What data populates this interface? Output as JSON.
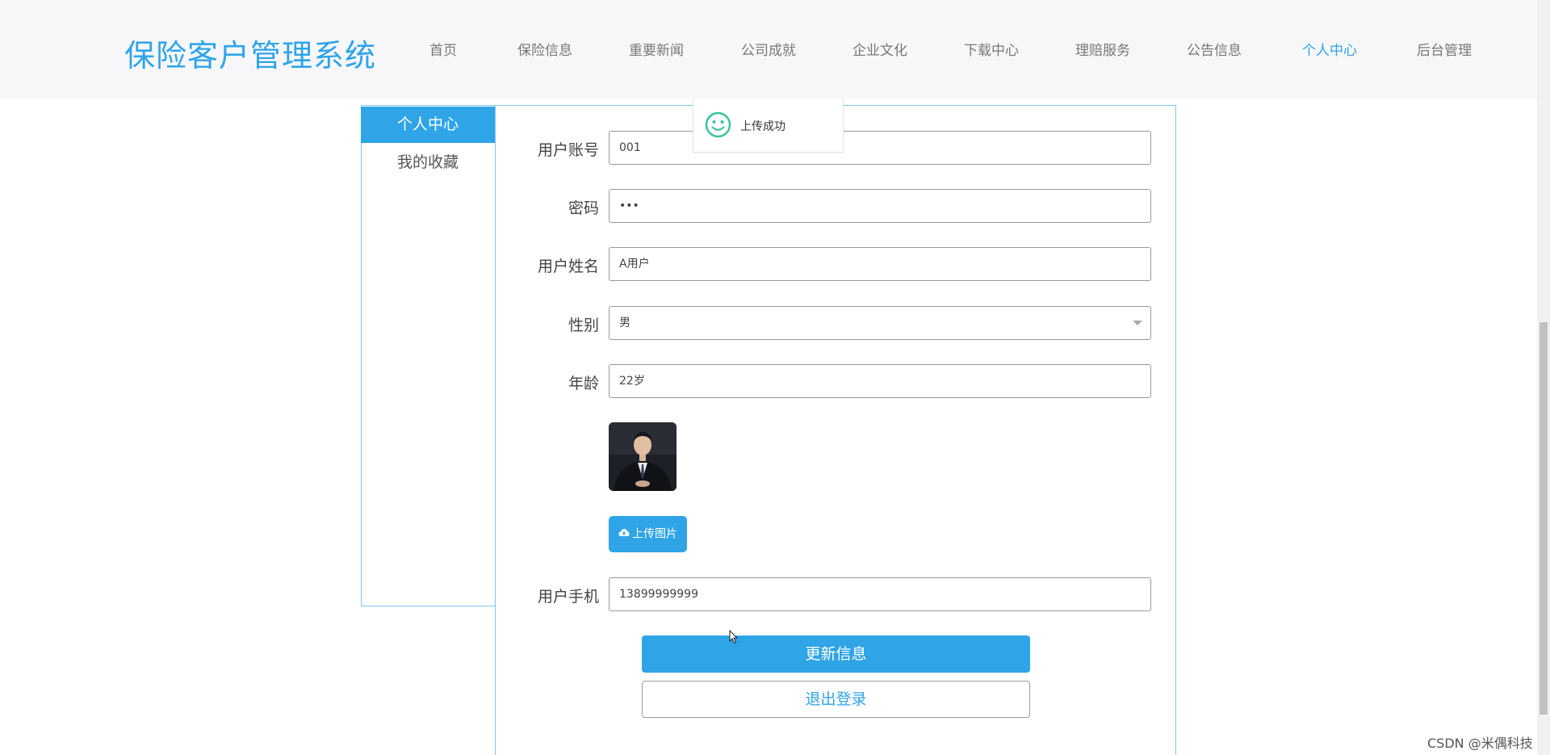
{
  "header": {
    "logo": "保险客户管理系统",
    "nav": [
      {
        "label": "首页"
      },
      {
        "label": "保险信息"
      },
      {
        "label": "重要新闻"
      },
      {
        "label": "公司成就"
      },
      {
        "label": "企业文化"
      },
      {
        "label": "下载中心"
      },
      {
        "label": "理赔服务"
      },
      {
        "label": "公告信息"
      },
      {
        "label": "个人中心"
      },
      {
        "label": "后台管理"
      }
    ],
    "active_nav": "个人中心"
  },
  "sidebar": {
    "items": [
      {
        "label": "个人中心"
      },
      {
        "label": "我的收藏"
      }
    ]
  },
  "form": {
    "account": {
      "label": "用户账号",
      "value": "001"
    },
    "password": {
      "label": "密码",
      "value": "•••"
    },
    "name": {
      "label": "用户姓名",
      "value": "A用户"
    },
    "gender": {
      "label": "性别",
      "value": "男"
    },
    "age": {
      "label": "年龄",
      "value": "22岁"
    },
    "upload_button": "上传图片",
    "phone": {
      "label": "用户手机",
      "value": "13899999999"
    },
    "update_button": "更新信息",
    "logout_button": "退出登录"
  },
  "toast": {
    "message": "上传成功"
  },
  "watermark": "CSDN @米偶科技",
  "colors": {
    "accent": "#2fa4e7",
    "toast_icon": "#3cc29a"
  }
}
